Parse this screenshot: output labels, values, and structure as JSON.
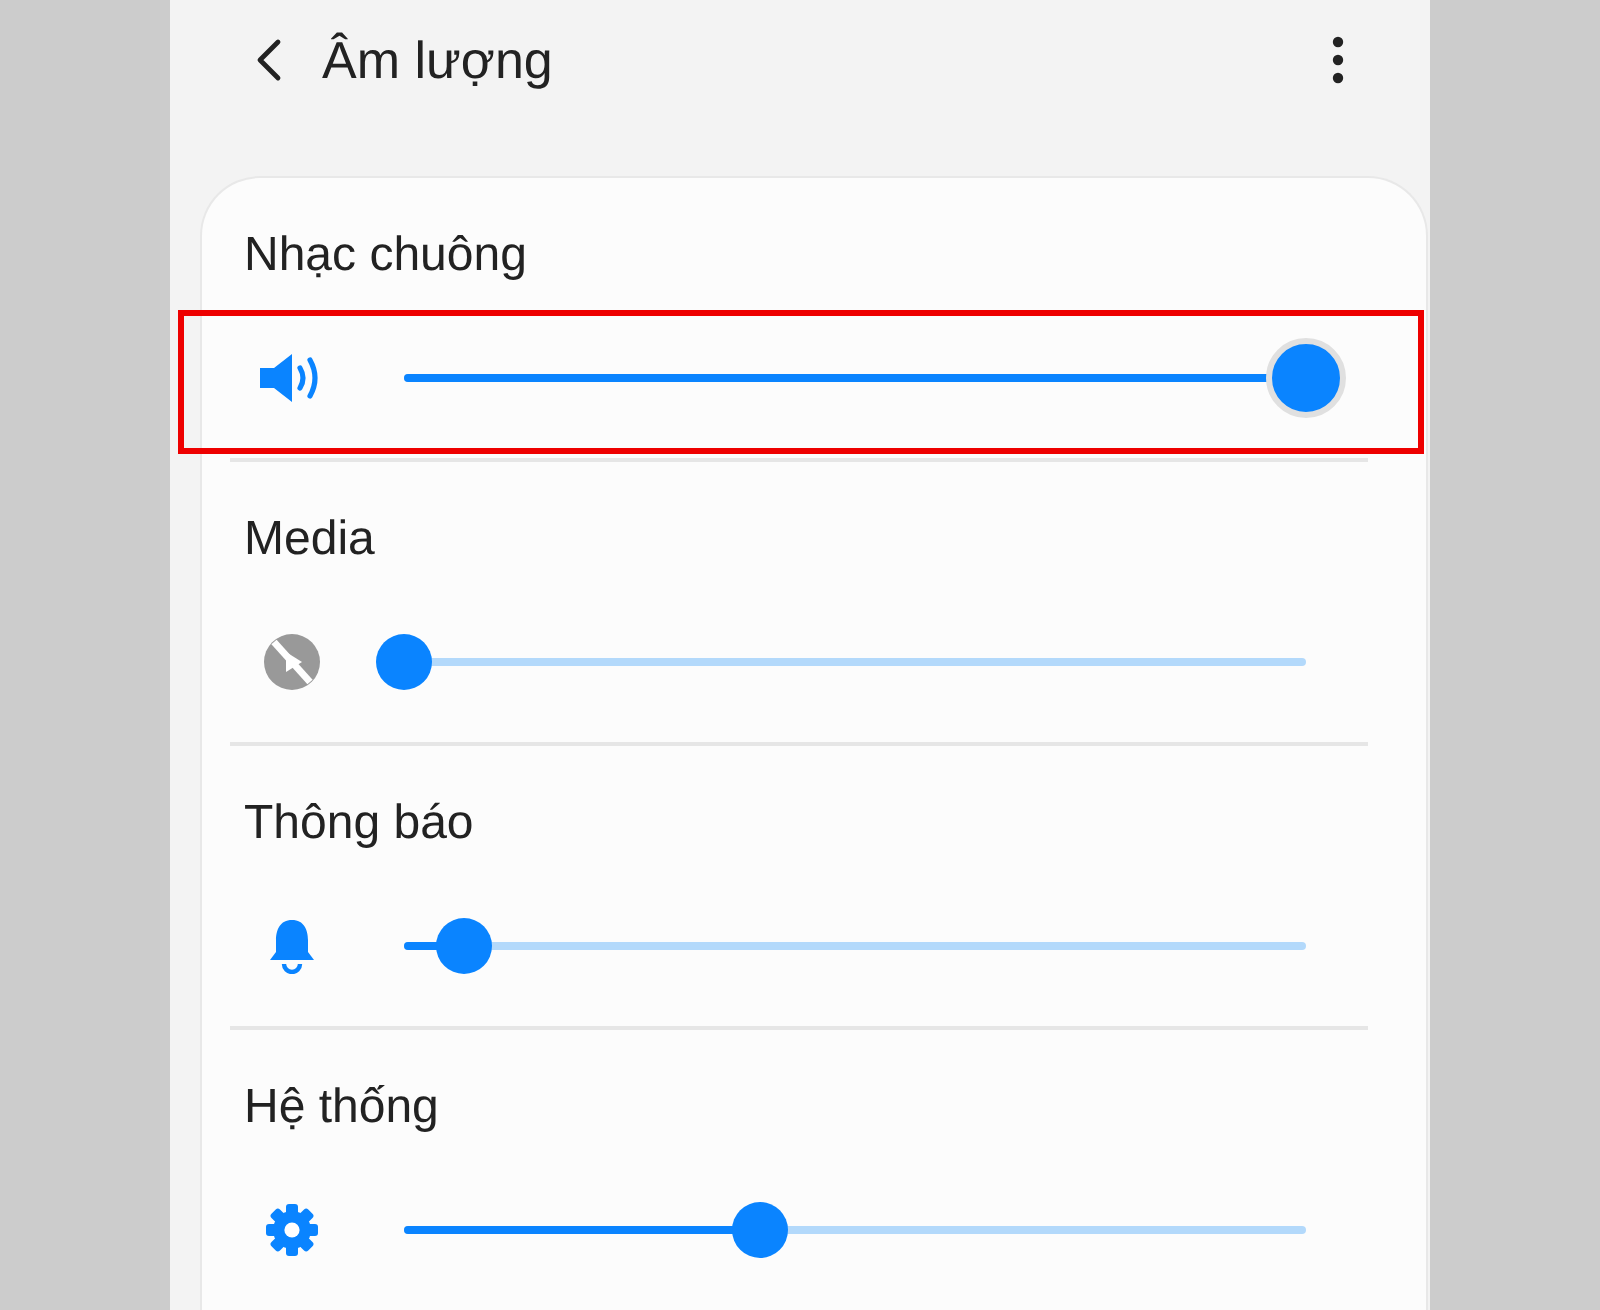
{
  "header": {
    "title": "Âm lượng"
  },
  "channels": [
    {
      "name": "Nhạc chuông",
      "kind": "speaker",
      "muted": false,
      "level": 1.0,
      "highlighted": true
    },
    {
      "name": "Media",
      "kind": "media",
      "muted": true,
      "level": 0.0,
      "highlighted": false
    },
    {
      "name": "Thông báo",
      "kind": "bell",
      "muted": false,
      "level": 0.066,
      "highlighted": false
    },
    {
      "name": "Hệ thống",
      "kind": "gear",
      "muted": false,
      "level": 0.394,
      "highlighted": false
    }
  ]
}
